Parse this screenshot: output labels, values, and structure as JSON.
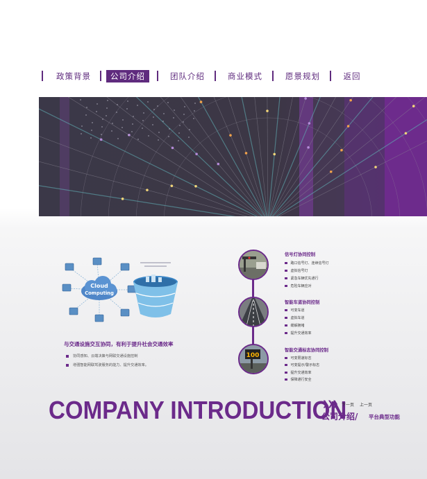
{
  "nav": {
    "items": [
      {
        "label": "政策背景",
        "active": false
      },
      {
        "label": "公司介绍",
        "active": true
      },
      {
        "label": "团队介绍",
        "active": false
      },
      {
        "label": "商业模式",
        "active": false
      },
      {
        "label": "愿景规划",
        "active": false
      },
      {
        "label": "返回",
        "active": false
      }
    ]
  },
  "colors": {
    "brand": "#5f2b7e",
    "accent": "#6b2a8a"
  },
  "illustration": {
    "cloud_line1": "Cloud",
    "cloud_line2": "Computing"
  },
  "left": {
    "title": "与交通设施交互协同，有利于提升社会交通效率",
    "bullets": [
      "协同感知、云端决策与网联交通设施控制",
      "增强智能网联驾驶服务的能力、提升交通效率。"
    ]
  },
  "features": [
    {
      "title": "信号灯协同控制",
      "items": [
        "路口信号灯、连续信号灯",
        "虚拟信号灯",
        "紧急车辆优先通行",
        "危险车辆应对"
      ]
    },
    {
      "title": "智能车道协同控制",
      "items": [
        "可变车道",
        "虚拟车道",
        "缓解拥堵",
        "提升交通效率"
      ]
    },
    {
      "title": "智能交通标志协同控制",
      "items": [
        "可变限速标志",
        "可变提示/警示标志",
        "提升交通效率",
        "保障通行安全"
      ]
    }
  ],
  "sign_number": "100",
  "footer": {
    "heading": "COMPANY INTRODUCTION",
    "next": "下一页",
    "prev": "上一页",
    "section": "公司介绍/",
    "section_sub": "平台典型功能"
  }
}
